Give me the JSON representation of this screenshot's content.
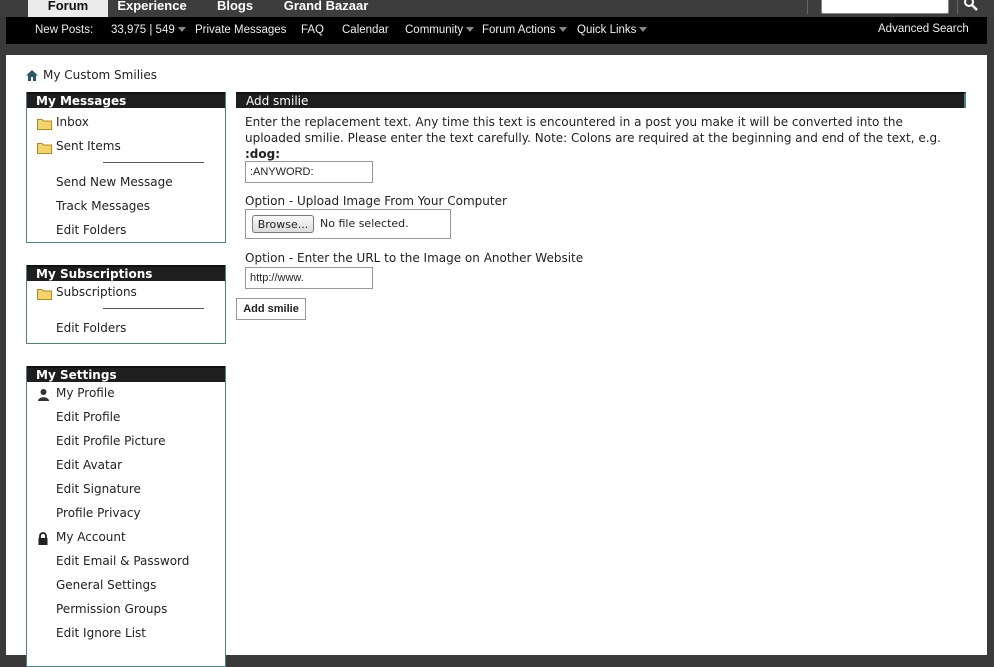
{
  "tabs": [
    {
      "label": "Forum"
    },
    {
      "label": "Experience"
    },
    {
      "label": "Blogs"
    },
    {
      "label": "Grand Bazaar"
    }
  ],
  "search": {
    "placeholder": ""
  },
  "nav": {
    "new_posts": "New Posts:",
    "counts": "33,975 | 549",
    "private_messages": "Private Messages",
    "faq": "FAQ",
    "calendar": "Calendar",
    "community": "Community",
    "forum_actions": "Forum Actions",
    "quick_links": "Quick Links",
    "advanced_search": "Advanced Search"
  },
  "breadcrumb": {
    "label": "My Custom Smilies"
  },
  "sidebar": {
    "messages": {
      "title": "My Messages",
      "inbox": "Inbox",
      "sent": "Sent Items",
      "send_new": "Send New Message",
      "track": "Track Messages",
      "edit_folders": "Edit Folders"
    },
    "subscriptions": {
      "title": "My Subscriptions",
      "subscriptions": "Subscriptions",
      "edit_folders": "Edit Folders"
    },
    "settings": {
      "title": "My Settings",
      "profile": "My Profile",
      "edit_profile": "Edit Profile",
      "edit_picture": "Edit Profile Picture",
      "edit_avatar": "Edit Avatar",
      "edit_signature": "Edit Signature",
      "privacy": "Profile Privacy",
      "account": "My Account",
      "email_password": "Edit Email & Password",
      "general": "General Settings",
      "permission_groups": "Permission Groups",
      "ignore_list": "Edit Ignore List"
    }
  },
  "main": {
    "title": "Add smilie",
    "description": "Enter the replacement text. Any time this text is encountered in a post you make it will be converted into the uploaded smilie. Please enter the text carefully. Note: Colons are required at the beginning and end of the text, e.g.",
    "example": ":dog:",
    "text_value": ":ANYWORD:",
    "upload_label": "Option - Upload Image From Your Computer",
    "browse_label": "Browse...",
    "no_file": "No file selected.",
    "url_label": "Option - Enter the URL to the Image on Another Website",
    "url_value": "http://www.",
    "submit_label": "Add smilie"
  },
  "colors": {
    "accent": "#4f7f88",
    "header_bg": "#1e1e1e",
    "nav_bg": "#000000"
  }
}
